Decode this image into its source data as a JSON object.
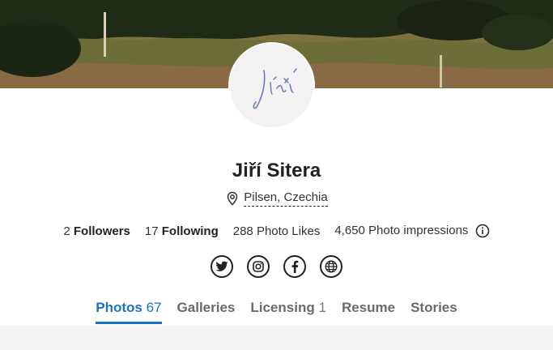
{
  "profile": {
    "avatar_signature": "Jiří",
    "name": "Jiří Sitera",
    "location": "Pilsen, Czechia"
  },
  "stats": {
    "followers_count": "2",
    "followers_label": "Followers",
    "following_count": "17",
    "following_label": "Following",
    "photo_likes": "288 Photo Likes",
    "photo_impressions": "4,650 Photo impressions"
  },
  "social": {
    "icons": [
      "twitter-icon",
      "instagram-icon",
      "facebook-icon",
      "website-globe-icon"
    ]
  },
  "tabs": [
    {
      "label": "Photos",
      "count": "67",
      "active": true
    },
    {
      "label": "Galleries",
      "count": ""
    },
    {
      "label": "Licensing",
      "count": "1"
    },
    {
      "label": "Resume",
      "count": ""
    },
    {
      "label": "Stories",
      "count": ""
    }
  ],
  "colors": {
    "accent": "#1a73c8",
    "text": "#222222",
    "tab_inactive": "#6a6a6a",
    "footer_bg": "#f4f5f7"
  }
}
